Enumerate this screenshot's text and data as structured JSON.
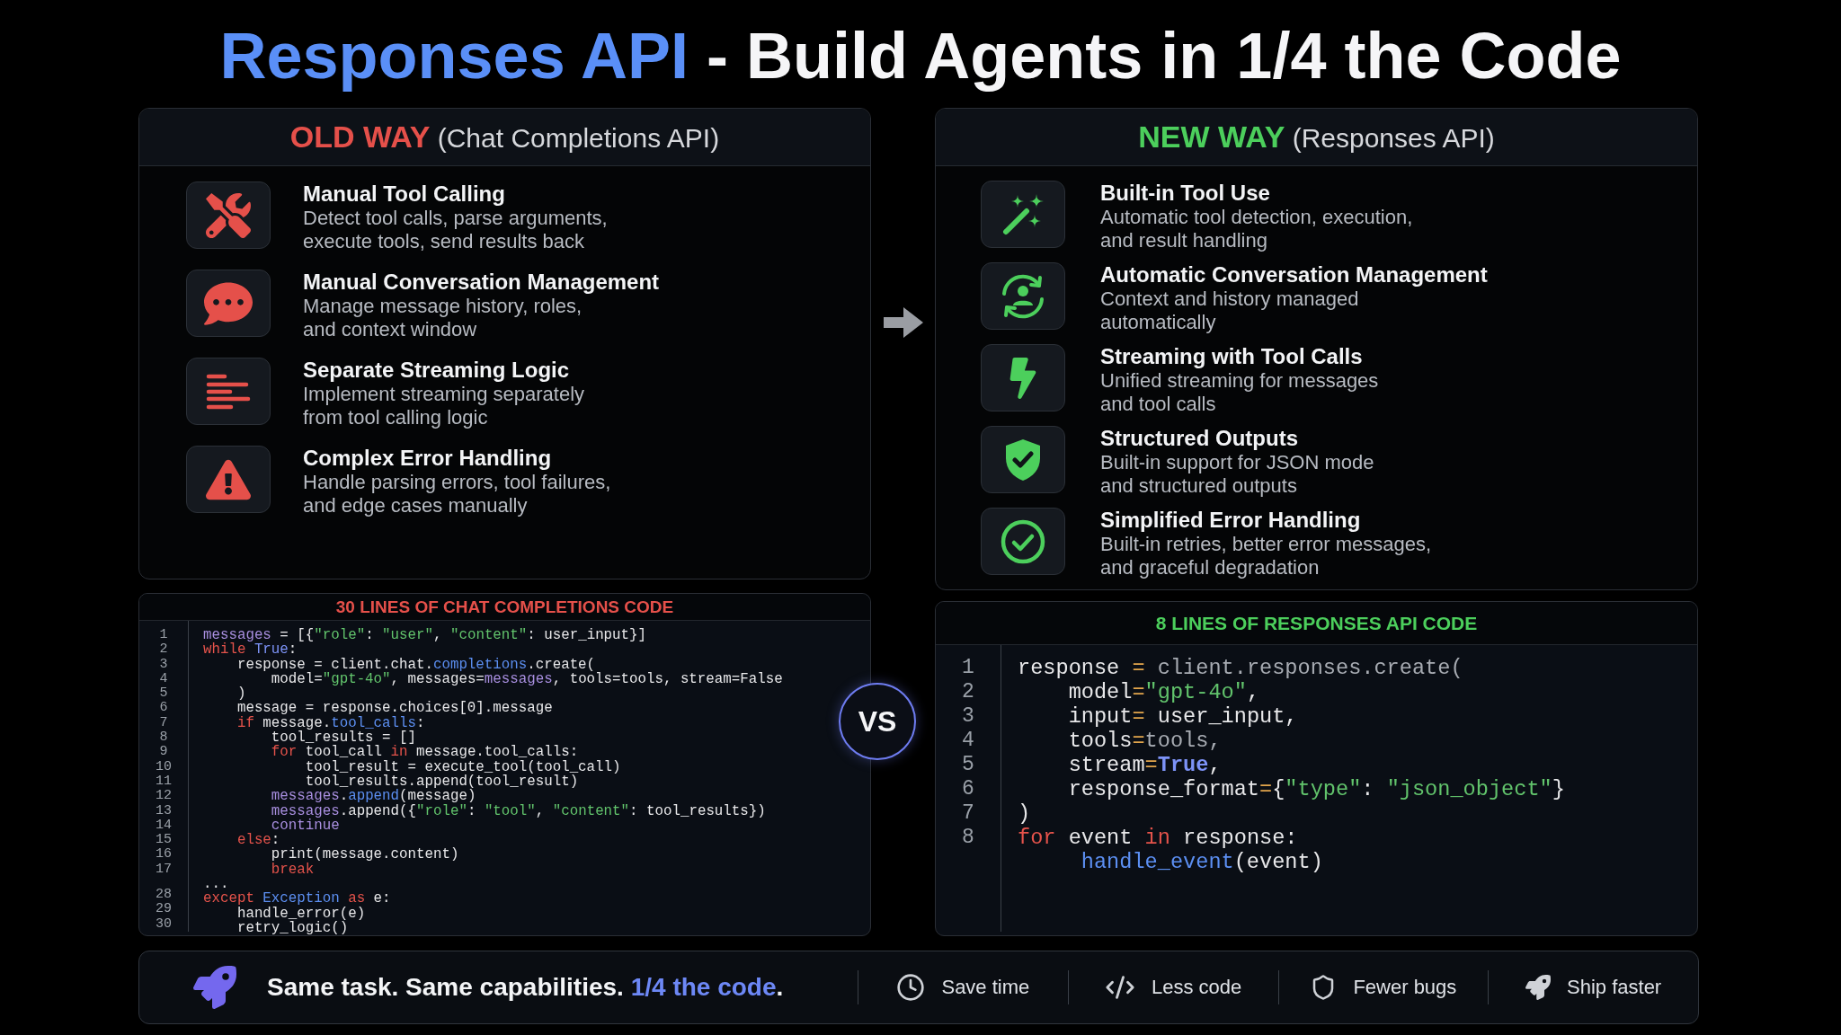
{
  "title": {
    "accent": "Responses API",
    "text": "- Build Agents in 1/4 the Code"
  },
  "columns": [
    {
      "kind": "old",
      "heading": {
        "label": "OLD WAY",
        "subtitle": "(Chat Completions API)"
      },
      "features": [
        {
          "title": "Manual Tool Calling",
          "description": "Detect tool calls, parse arguments,\nexecute tools, send results back"
        },
        {
          "title": "Manual Conversation Management",
          "description": "Manage message history, roles,\nand context window"
        },
        {
          "title": "Separate Streaming Logic",
          "description": "Implement streaming separately\nfrom tool calling logic"
        },
        {
          "title": "Complex Error Handling",
          "description": "Handle parsing errors, tool failures,\nand edge cases manually"
        }
      ],
      "code": {
        "title": "30 LINES OF CHAT COMPLETIONS CODE",
        "lines": [
          {
            "number": "1",
            "tokens": [
              {
                "kind": "variable",
                "text": "messages"
              },
              {
                "kind": "plain",
                "text": " = [{"
              },
              {
                "kind": "string",
                "text": "\"role\""
              },
              {
                "kind": "plain",
                "text": ": "
              },
              {
                "kind": "string",
                "text": "\"user\""
              },
              {
                "kind": "plain",
                "text": ", "
              },
              {
                "kind": "string",
                "text": "\"content\""
              },
              {
                "kind": "plain",
                "text": ": user_input}]"
              }
            ]
          },
          {
            "number": "2",
            "tokens": [
              {
                "kind": "keyword",
                "text": "while"
              },
              {
                "kind": "constant",
                "text": " True"
              },
              {
                "kind": "plain",
                "text": ":"
              }
            ]
          },
          {
            "number": "3",
            "tokens": [
              {
                "kind": "plain",
                "text": "    response = client.chat."
              },
              {
                "kind": "function",
                "text": "completions"
              },
              {
                "kind": "plain",
                "text": ".create("
              }
            ]
          },
          {
            "number": "4",
            "tokens": [
              {
                "kind": "plain",
                "text": "        model="
              },
              {
                "kind": "string",
                "text": "\"gpt-4o\""
              },
              {
                "kind": "plain",
                "text": ", messages="
              },
              {
                "kind": "variable",
                "text": "messages"
              },
              {
                "kind": "plain",
                "text": ", tools=tools, stream=False"
              }
            ]
          },
          {
            "number": "5",
            "tokens": [
              {
                "kind": "plain",
                "text": "    )"
              }
            ]
          },
          {
            "number": "6",
            "tokens": [
              {
                "kind": "plain",
                "text": "    message = response.choices[0].message"
              }
            ]
          },
          {
            "number": "7",
            "tokens": [
              {
                "kind": "keyword",
                "text": "    if"
              },
              {
                "kind": "plain",
                "text": " message."
              },
              {
                "kind": "function",
                "text": "tool_calls"
              },
              {
                "kind": "plain",
                "text": ":"
              }
            ]
          },
          {
            "number": "8",
            "tokens": [
              {
                "kind": "plain",
                "text": "        tool_results = []"
              }
            ]
          },
          {
            "number": "9",
            "tokens": [
              {
                "kind": "keyword",
                "text": "        for"
              },
              {
                "kind": "plain",
                "text": " tool_call "
              },
              {
                "kind": "keyword",
                "text": "in"
              },
              {
                "kind": "plain",
                "text": " message.tool_calls:"
              }
            ]
          },
          {
            "number": "10",
            "tokens": [
              {
                "kind": "plain",
                "text": "            tool_result = execute_tool(tool_call)"
              }
            ]
          },
          {
            "number": "11",
            "tokens": [
              {
                "kind": "plain",
                "text": "            tool_results.append(tool_result)"
              }
            ]
          },
          {
            "number": "12",
            "tokens": [
              {
                "kind": "variable",
                "text": "        messages"
              },
              {
                "kind": "plain",
                "text": "."
              },
              {
                "kind": "function",
                "text": "append"
              },
              {
                "kind": "plain",
                "text": "(message)"
              }
            ]
          },
          {
            "number": "13",
            "tokens": [
              {
                "kind": "variable",
                "text": "        messages"
              },
              {
                "kind": "plain",
                "text": ".append({"
              },
              {
                "kind": "string",
                "text": "\"role\""
              },
              {
                "kind": "plain",
                "text": ": "
              },
              {
                "kind": "string",
                "text": "\"tool\""
              },
              {
                "kind": "plain",
                "text": ", "
              },
              {
                "kind": "string",
                "text": "\"content\""
              },
              {
                "kind": "plain",
                "text": ": tool_results})"
              }
            ]
          },
          {
            "number": "14",
            "tokens": [
              {
                "kind": "control",
                "text": "        continue"
              }
            ]
          },
          {
            "number": "15",
            "tokens": [
              {
                "kind": "keyword",
                "text": "    else"
              },
              {
                "kind": "plain",
                "text": ":"
              }
            ]
          },
          {
            "number": "16",
            "tokens": [
              {
                "kind": "plain",
                "text": "        print(message.content)"
              }
            ]
          },
          {
            "number": "17",
            "tokens": [
              {
                "kind": "keyword",
                "text": "        break"
              }
            ]
          },
          {
            "tokens": [
              {
                "kind": "plain",
                "text": "..."
              }
            ]
          },
          {
            "number": "28",
            "tokens": [
              {
                "kind": "keyword",
                "text": "except"
              },
              {
                "kind": "function",
                "text": " Exception"
              },
              {
                "kind": "keyword",
                "text": " as"
              },
              {
                "kind": "plain",
                "text": " e:"
              }
            ]
          },
          {
            "number": "29",
            "tokens": [
              {
                "kind": "plain",
                "text": "    handle_error(e)"
              }
            ]
          },
          {
            "number": "30",
            "tokens": [
              {
                "kind": "plain",
                "text": "    retry_logic()"
              }
            ]
          }
        ]
      }
    },
    {
      "kind": "new",
      "heading": {
        "label": "NEW WAY",
        "subtitle": "(Responses API)"
      },
      "features": [
        {
          "title": "Built-in Tool Use",
          "description": "Automatic tool detection, execution,\nand result handling"
        },
        {
          "title": "Automatic Conversation Management",
          "description": "Context and history managed\nautomatically"
        },
        {
          "title": "Streaming with Tool Calls",
          "description": "Unified streaming for messages\nand tool calls"
        },
        {
          "title": "Structured Outputs",
          "description": "Built-in support for JSON mode\nand structured outputs"
        },
        {
          "title": "Simplified Error Handling",
          "description": "Built-in retries, better error messages,\nand graceful degradation"
        }
      ],
      "code": {
        "title": "8 LINES OF RESPONSES API CODE",
        "lines": [
          {
            "number": "1",
            "tokens": [
              {
                "kind": "plain",
                "text": "response "
              },
              {
                "kind": "operator",
                "text": "="
              },
              {
                "kind": "dim",
                "text": " client.responses.create("
              }
            ]
          },
          {
            "number": "2",
            "tokens": [
              {
                "kind": "plain",
                "text": "    model"
              },
              {
                "kind": "operator",
                "text": "="
              },
              {
                "kind": "string",
                "text": "\"gpt-4o\""
              },
              {
                "kind": "plain",
                "text": ","
              }
            ]
          },
          {
            "number": "3",
            "tokens": [
              {
                "kind": "plain",
                "text": "    input"
              },
              {
                "kind": "operator",
                "text": "="
              },
              {
                "kind": "plain",
                "text": " user_input,"
              }
            ]
          },
          {
            "number": "4",
            "tokens": [
              {
                "kind": "plain",
                "text": "    tools"
              },
              {
                "kind": "operator",
                "text": "="
              },
              {
                "kind": "dim",
                "text": "tools,"
              }
            ]
          },
          {
            "number": "5",
            "tokens": [
              {
                "kind": "plain",
                "text": "    stream"
              },
              {
                "kind": "operator",
                "text": "="
              },
              {
                "kind": "constant",
                "text": "True"
              },
              {
                "kind": "plain",
                "text": ","
              }
            ]
          },
          {
            "number": "6",
            "tokens": [
              {
                "kind": "plain",
                "text": "    response_format"
              },
              {
                "kind": "operator",
                "text": "="
              },
              {
                "kind": "plain",
                "text": "{"
              },
              {
                "kind": "string",
                "text": "\"type\""
              },
              {
                "kind": "plain",
                "text": ": "
              },
              {
                "kind": "string",
                "text": "\"json_object\""
              },
              {
                "kind": "plain",
                "text": "}"
              }
            ]
          },
          {
            "number": "7",
            "tokens": [
              {
                "kind": "plain",
                "text": ")"
              }
            ]
          },
          {
            "number": "8",
            "tokens": [
              {
                "kind": "keyword",
                "text": "for"
              },
              {
                "kind": "plain",
                "text": " event "
              },
              {
                "kind": "keyword",
                "text": "in"
              },
              {
                "kind": "plain",
                "text": " response:"
              }
            ]
          },
          {
            "tokens": [
              {
                "kind": "function",
                "text": "     handle_event"
              },
              {
                "kind": "plain",
                "text": "(event)"
              }
            ]
          }
        ]
      }
    }
  ],
  "vs": "VS",
  "summary": {
    "tagline": {
      "text": "Same task. Same capabilities.",
      "highlight": "1/4 the code",
      "end": "."
    },
    "benefits": [
      "Save time",
      "Less code",
      "Fewer bugs",
      "Ship faster"
    ]
  }
}
